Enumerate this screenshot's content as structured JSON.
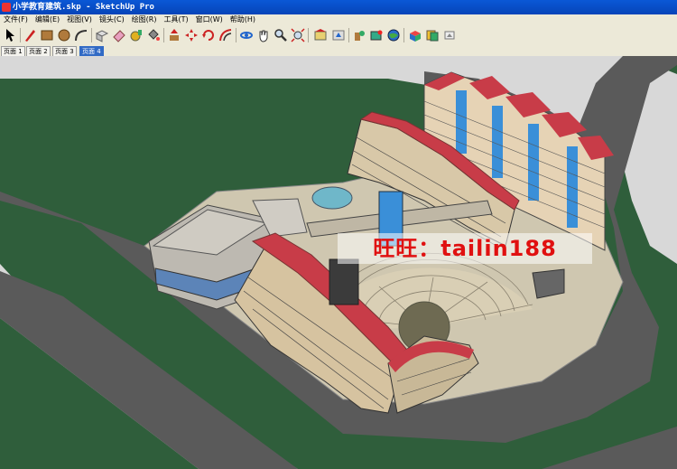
{
  "window": {
    "title": "小学教育建筑.skp - SketchUp Pro"
  },
  "menu": [
    "文件(F)",
    "编辑(E)",
    "视图(V)",
    "镜头(C)",
    "绘图(R)",
    "工具(T)",
    "窗口(W)",
    "帮助(H)"
  ],
  "tabs": [
    {
      "label": "页面 1",
      "active": false
    },
    {
      "label": "页面 2",
      "active": false
    },
    {
      "label": "页面 3",
      "active": false
    },
    {
      "label": "页面 4",
      "active": true
    }
  ],
  "watermark": "旺旺：tailin188",
  "colors": {
    "ground": "#2f5e3b",
    "road": "#5a5a5a",
    "roof": "#c83c48",
    "glass": "#3a8fd8",
    "plaza": "#cfc7b0"
  }
}
